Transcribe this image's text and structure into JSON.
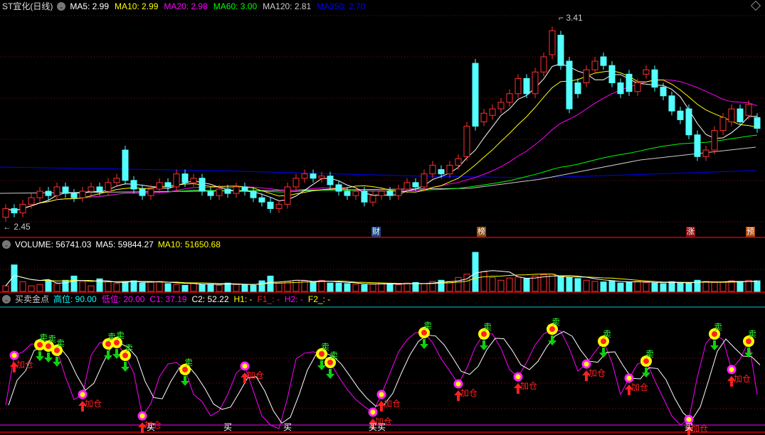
{
  "main": {
    "title": "ST宜化(日线)",
    "ma": [
      {
        "label": "MA5: 2.99",
        "color": "#ffffff"
      },
      {
        "label": "MA10: 2.99",
        "color": "#ffff00"
      },
      {
        "label": "MA20: 2.98",
        "color": "#ff00ff"
      },
      {
        "label": "MA60: 3.00",
        "color": "#00ff00"
      },
      {
        "label": "MA120: 2.81",
        "color": "#cccccc"
      },
      {
        "label": "MA250: 2.70",
        "color": "#0000ff"
      }
    ],
    "high_label": "3.41",
    "low_label": "2.45",
    "tags": [
      {
        "text": "财",
        "color": "#1a4a8a"
      },
      {
        "text": "榜",
        "color": "#8a4a10"
      },
      {
        "text": "涨",
        "color": "#8a1010"
      },
      {
        "text": "预",
        "color": "#b04a10"
      }
    ],
    "candles": [
      [
        2.48,
        2.52
      ],
      [
        2.52,
        2.5
      ],
      [
        2.5,
        2.54
      ],
      [
        2.54,
        2.57
      ],
      [
        2.57,
        2.6
      ],
      [
        2.6,
        2.58
      ],
      [
        2.58,
        2.62
      ],
      [
        2.62,
        2.59
      ],
      [
        2.59,
        2.57
      ],
      [
        2.57,
        2.6
      ],
      [
        2.6,
        2.62
      ],
      [
        2.62,
        2.6
      ],
      [
        2.6,
        2.64
      ],
      [
        2.64,
        2.66
      ],
      [
        2.79,
        2.65
      ],
      [
        2.65,
        2.61
      ],
      [
        2.61,
        2.58
      ],
      [
        2.58,
        2.61
      ],
      [
        2.61,
        2.64
      ],
      [
        2.64,
        2.62
      ],
      [
        2.62,
        2.68
      ],
      [
        2.68,
        2.64
      ],
      [
        2.64,
        2.66
      ],
      [
        2.66,
        2.6
      ],
      [
        2.6,
        2.58
      ],
      [
        2.58,
        2.61
      ],
      [
        2.61,
        2.59
      ],
      [
        2.59,
        2.62
      ],
      [
        2.62,
        2.6
      ],
      [
        2.6,
        2.57
      ],
      [
        2.57,
        2.55
      ],
      [
        2.55,
        2.52
      ],
      [
        2.52,
        2.54
      ],
      [
        2.54,
        2.62
      ],
      [
        2.62,
        2.66
      ],
      [
        2.66,
        2.68
      ],
      [
        2.68,
        2.66
      ],
      [
        2.66,
        2.67
      ],
      [
        2.67,
        2.63
      ],
      [
        2.63,
        2.6
      ],
      [
        2.6,
        2.58
      ],
      [
        2.58,
        2.6
      ],
      [
        2.6,
        2.55
      ],
      [
        2.55,
        2.58
      ],
      [
        2.58,
        2.6
      ],
      [
        2.6,
        2.58
      ],
      [
        2.58,
        2.61
      ],
      [
        2.61,
        2.64
      ],
      [
        2.64,
        2.62
      ],
      [
        2.62,
        2.68
      ],
      [
        2.68,
        2.72
      ],
      [
        2.7,
        2.68
      ],
      [
        2.68,
        2.72
      ],
      [
        2.72,
        2.75
      ],
      [
        2.76,
        2.9
      ],
      [
        3.19,
        2.9
      ],
      [
        2.92,
        2.96
      ],
      [
        2.95,
        2.98
      ],
      [
        2.98,
        3.01
      ],
      [
        3.01,
        3.05
      ],
      [
        3.05,
        3.12
      ],
      [
        3.12,
        3.05
      ],
      [
        3.05,
        3.15
      ],
      [
        3.15,
        3.22
      ],
      [
        3.23,
        3.34
      ],
      [
        3.32,
        3.18
      ],
      [
        3.2,
        2.98
      ],
      [
        3.1,
        3.05
      ],
      [
        3.1,
        3.16
      ],
      [
        3.16,
        3.2
      ],
      [
        3.22,
        3.18
      ],
      [
        3.18,
        3.1
      ],
      [
        3.1,
        3.05
      ],
      [
        3.14,
        3.06
      ],
      [
        3.06,
        3.1
      ],
      [
        3.14,
        3.16
      ],
      [
        3.16,
        3.08
      ],
      [
        3.08,
        3.04
      ],
      [
        3.04,
        2.97
      ],
      [
        2.97,
        2.93
      ],
      [
        2.98,
        2.86
      ],
      [
        2.86,
        2.76
      ],
      [
        2.76,
        2.79
      ],
      [
        2.79,
        2.88
      ],
      [
        2.88,
        2.94
      ],
      [
        2.92,
        2.98
      ],
      [
        2.98,
        2.92
      ],
      [
        2.95,
        3.0
      ],
      [
        2.94,
        2.89
      ]
    ]
  },
  "volume": {
    "label": "VOLUME: 56741.03",
    "ma5": "MA5: 59844.27",
    "ma10": "MA10: 51650.68",
    "values": [
      20000,
      95000,
      35000,
      20000,
      25000,
      40000,
      28000,
      40000,
      55000,
      35000,
      20000,
      45000,
      35000,
      28000,
      35000,
      38000,
      30000,
      35000,
      36000,
      28000,
      25000,
      22000,
      30000,
      25000,
      26000,
      22000,
      30000,
      25000,
      24000,
      22000,
      38000,
      55000,
      30000,
      36000,
      40000,
      38000,
      34000,
      40000,
      30000,
      30000,
      28000,
      26000,
      24000,
      26000,
      30000,
      28000,
      24000,
      30000,
      32000,
      28000,
      36000,
      40000,
      36000,
      50000,
      62000,
      140000,
      70000,
      50000,
      40000,
      48000,
      52000,
      46000,
      55000,
      60000,
      62000,
      56000,
      50000,
      46000,
      40000,
      36000,
      34000,
      38000,
      30000,
      34000,
      36000,
      32000,
      30000,
      28000,
      35000,
      32000,
      30000,
      40000,
      36000,
      32000,
      34000,
      38000,
      36000,
      40000,
      38000
    ]
  },
  "indicator": {
    "title": "买卖金点",
    "items": [
      {
        "label": "高位: 90.00",
        "color": "#00ffff"
      },
      {
        "label": "低位: 20.00",
        "color": "#ff00ff"
      },
      {
        "label": "C1: 37.19",
        "color": "#ff00ff"
      },
      {
        "label": "C2: 52.22",
        "color": "#ffffff"
      },
      {
        "label": "H1: -",
        "color": "#ffff00"
      },
      {
        "label": "F1_: -",
        "color": "#ff2020"
      },
      {
        "label": "H2: -",
        "color": "#ff00ff"
      },
      {
        "label": "F2_: -",
        "color": "#ffff00"
      }
    ],
    "sell_text": "卖",
    "add_text": "加仓",
    "buy_text": "买",
    "line": [
      31.8,
      61.3,
      63.4,
      68.1,
      67.6,
      66.8,
      64.3,
      48.6,
      35.1,
      38.1,
      61.3,
      68.9,
      68.1,
      68.9,
      61.3,
      50.8,
      25.4,
      32.6,
      48.6,
      56.2,
      57.1,
      52.9,
      38.1,
      33.9,
      25.4,
      28.4,
      38.1,
      50.8,
      55,
      40.2,
      25.4,
      20,
      17.8,
      36,
      59.2,
      62.6,
      63.4,
      62.2,
      57.1,
      48.6,
      41,
      35.1,
      30.9,
      27.6,
      38.1,
      50.8,
      63.4,
      70.6,
      74.8,
      74.8,
      68.9,
      59.2,
      52,
      44.4,
      53.7,
      66.4,
      74,
      74,
      65.5,
      52.9,
      48.6,
      57.1,
      67.6,
      74,
      76.9,
      75.7,
      65.5,
      52,
      56.2,
      63.4,
      69.7,
      57.1,
      38.1,
      47.8,
      56.2,
      57.9,
      46.5,
      36,
      25.4,
      20,
      23.3,
      48.6,
      68.5,
      74,
      70.6,
      52.9,
      59.2,
      69.7,
      38.1
    ],
    "sells": [
      4,
      5,
      6,
      12,
      13,
      14,
      21,
      37,
      38,
      49,
      56,
      64,
      70,
      75,
      83,
      87
    ],
    "adds": [
      1,
      9,
      16,
      28,
      43,
      44,
      53,
      60,
      68,
      73,
      80,
      85
    ],
    "buys": [
      17,
      26,
      33,
      43,
      44,
      80
    ]
  }
}
